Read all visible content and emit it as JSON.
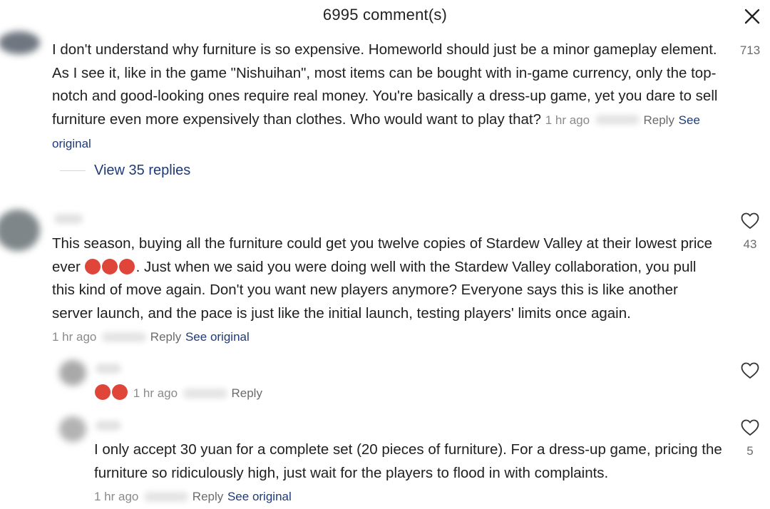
{
  "header": {
    "title": "6995 comment(s)",
    "close_icon": "close-icon"
  },
  "comments": [
    {
      "text": "I don't understand why furniture is so expensive. Homeworld should just be a minor gameplay element. As I see it, like in the game \"Nishuihan\", most items can be bought with in-game currency, only the top-notch and good-looking ones require real money. You're basically a dress-up game, yet you dare to sell furniture even more expensively than clothes. Who would want to play that?",
      "time": "1 hr ago",
      "reply": "Reply",
      "see_original": "See original",
      "likes": "713",
      "view_replies": "View 35 replies"
    },
    {
      "text_before_emoji": "This season, buying all the furniture could get you twelve copies of Stardew Valley at their lowest price ever ",
      "emoji": "angry-devil-emoji",
      "text_after_emoji": ". Just when we said you were doing well with the Stardew Valley collaboration, you pull this kind of move again. Don't you want new players anymore? Everyone says this is like another server launch, and the pace is just like the initial launch, testing players' limits once again.",
      "time": "1 hr ago",
      "reply": "Reply",
      "see_original": "See original",
      "likes": "43"
    }
  ],
  "replies": [
    {
      "emoji": "angry-devil-emoji",
      "time": "1 hr ago",
      "reply": "Reply"
    },
    {
      "text": "I only accept 30 yuan for a complete set (20 pieces of furniture). For a dress-up game, pricing the furniture so ridiculously high, just wait for the players to flood in with complaints.",
      "time": "1 hr ago",
      "reply": "Reply",
      "see_original": "See original",
      "likes": "5"
    }
  ],
  "colors": {
    "link": "#1e3a78",
    "muted": "#8a8a8a",
    "text": "#1f1f1f"
  }
}
